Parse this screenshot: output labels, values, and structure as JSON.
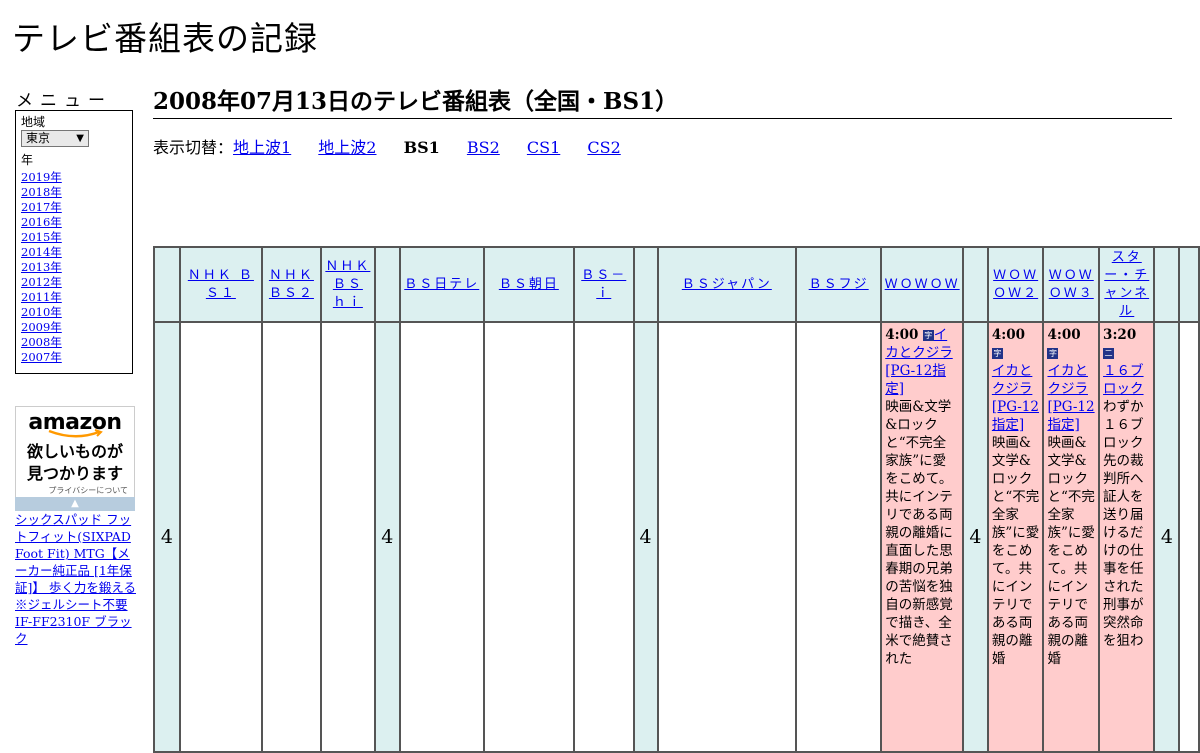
{
  "site": {
    "title": "テレビ番組表の記録"
  },
  "sidebar": {
    "menu_label": "メニュー",
    "region_label": "地域",
    "region_value": "東京",
    "year_label": "年",
    "years": [
      "2019年",
      "2018年",
      "2017年",
      "2016年",
      "2015年",
      "2014年",
      "2013年",
      "2012年",
      "2011年",
      "2010年",
      "2009年",
      "2008年",
      "2007年"
    ]
  },
  "ad": {
    "logo": "amazon",
    "tagline_1": "欲しいものが",
    "tagline_2": "見つかります",
    "privacy": "プライバシーについて",
    "product": "シックスパッド フットフィット(SIXPAD Foot Fit) MTG【メーカー純正品 [1年保証]】 歩く力を鍛える ※ジェルシート不要 IF-FF2310F ブラック"
  },
  "main": {
    "heading": "2008年07月13日のテレビ番組表（全国・BS1）",
    "switch_prefix": "表示切替：",
    "switch": [
      {
        "label": "地上波1",
        "link": true
      },
      {
        "label": "地上波2",
        "link": true
      },
      {
        "label": "BS1",
        "link": false
      },
      {
        "label": "BS2",
        "link": true
      },
      {
        "label": "CS1",
        "link": true
      },
      {
        "label": "CS2",
        "link": true
      }
    ]
  },
  "grid": {
    "hour": "4",
    "channels": [
      "ＮＨＫ ＢＳ１",
      "ＮＨＫ ＢＳ２",
      "ＮＨＫ ＢＳ ｈｉ",
      "ＢＳ日テレ",
      "ＢＳ朝日",
      "ＢＳ－ｉ",
      "ＢＳジャパン",
      "ＢＳフジ",
      "ＷＯＷＯＷ",
      "ＷＯＷＯＷ２",
      "ＷＯＷＯＷ３",
      "スター・チャンネル"
    ],
    "programs": {
      "wowow": {
        "time": "4:00",
        "icon": "字",
        "title": "イカとクジラ",
        "rating": "[PG-12指定]",
        "desc": "映画&文学&ロックと“不完全家族”に愛をこめて。共にインテリである両親の離婚に直面した思春期の兄弟の苦悩を独自の新感覚で描き、全米で絶賛された"
      },
      "wowow2": {
        "time": "4:00",
        "icon": "字",
        "title": "イカとクジラ",
        "rating": "[PG-12指定]",
        "desc": "映画&文学&ロックと“不完全家族”に愛をこめて。共にインテリである両親の離婚"
      },
      "wowow3": {
        "time": "4:00",
        "icon": "字",
        "title": "イカとクジラ",
        "rating": "[PG-12指定]",
        "desc": "映画&文学&ロックと“不完全家族”に愛をこめて。共にインテリである両親の離婚"
      },
      "star": {
        "time": "3:20",
        "icon": "二",
        "title": "１６ブロック",
        "desc": "わずか１６ブロック先の裁判所へ証人を送り届けるだけの仕事を任された刑事が突然命を狙わ"
      }
    }
  }
}
